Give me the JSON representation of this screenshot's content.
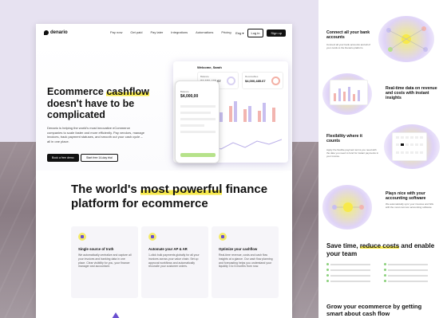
{
  "nav": {
    "brand": "denario",
    "links": [
      "Pay now",
      "Get paid",
      "Pay later",
      "Integrations",
      "Automations",
      "Pricing"
    ],
    "lang": "Eng",
    "login": "Log in",
    "signup": "Sign up"
  },
  "hero": {
    "title_a": "Ecommerce ",
    "title_hl": "cashflow",
    "title_b": " doesn't have to be complicated",
    "body": "Denario is helping the world's most innovative eCommerce companies to scale faster and more efficiently. Pay vendors, manage invoices, track payment statuses, and smooth out your cash cycle – all in one place.",
    "cta_primary": "Book a free demo",
    "cta_secondary": "Start free 14-day trial"
  },
  "dashboard": {
    "welcome": "Welcome, Sarah",
    "balance_lbl": "Balance",
    "balance": "$3,950,485.67",
    "receivables_lbl": "Receivables",
    "receivables": "$4,000,485.67",
    "chart_lbl": "Vendor Portal",
    "cashflow_lbl": "Net cash flow"
  },
  "phone": {
    "label": "Balance",
    "amount": "$4,000,00"
  },
  "section2": {
    "title_a": "The world's ",
    "title_hl": "most powerful",
    "title_b": " finance platform for ecommerce"
  },
  "features": [
    {
      "title": "Single source of truth",
      "body": "We automatically centralize and capture all your invoices and banking data in one place. Clear visibility for you, your finance manager and accountant."
    },
    {
      "title": "Automate your AP & AR",
      "body": "1-click bulk payments globally for all your invoices across your value chain. Set up approval workflows and automatically reconcile your customer orders."
    },
    {
      "title": "Optimize your cashflow",
      "body": "Real-time revenue, costs and cash flow insights at a glance. Our cash flow planning and forecasting helps you understand your liquidity 3 to 6 months from now."
    }
  ],
  "right": {
    "blocks": [
      {
        "title": "Connect all your bank accounts",
        "body": "Connect all your bank accounts and all of your cards to the Denario platform."
      },
      {
        "title": "Real-time data on revenue and costs with instant insights",
        "body": ""
      },
      {
        "title": "Flexibility where it counts",
        "body": "Apply the flexible payment terms you need with the date you need to fund for instant payments in your invoice."
      },
      {
        "title": "Plays nice with your accounting software",
        "body": "We automatically sync your invoices and bills with the most common accounting software."
      }
    ],
    "save_a": "Save time, ",
    "save_hl": "reduce costs",
    "save_b": " and enable your team",
    "grow": "Grow your ecommerce by getting smart about cash flow"
  },
  "colors": {
    "accent": "#f7e94a",
    "purple": "#6a4fd0",
    "dark": "#111111"
  }
}
